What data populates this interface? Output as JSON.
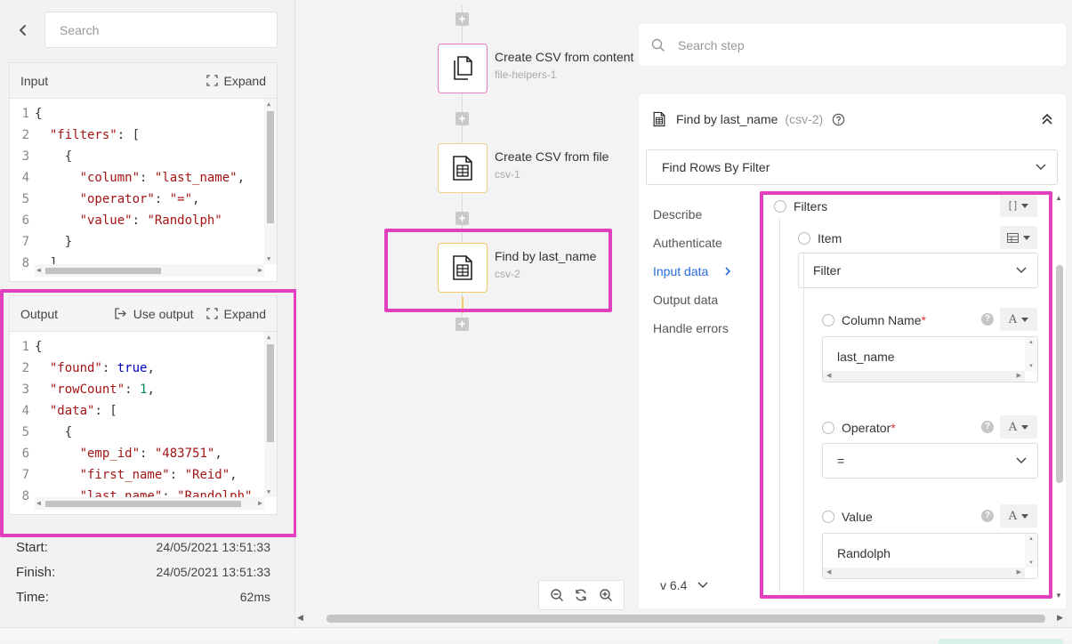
{
  "left": {
    "search_placeholder": "Search",
    "input_panel": {
      "title": "Input",
      "expand_label": "Expand",
      "lines": [
        {
          "n": "1",
          "html": "{"
        },
        {
          "n": "2",
          "html": "  <span class=\"key\">\"filters\"</span>: ["
        },
        {
          "n": "3",
          "html": "    {"
        },
        {
          "n": "4",
          "html": "      <span class=\"key\">\"column\"</span>: <span class=\"str\">\"last_name\"</span>,"
        },
        {
          "n": "5",
          "html": "      <span class=\"key\">\"operator\"</span>: <span class=\"str\">\"=\"</span>,"
        },
        {
          "n": "6",
          "html": "      <span class=\"key\">\"value\"</span>: <span class=\"str\">\"Randolph\"</span>"
        },
        {
          "n": "7",
          "html": "    }"
        },
        {
          "n": "8",
          "html": "  ],"
        }
      ]
    },
    "output_panel": {
      "title": "Output",
      "use_output_label": "Use output",
      "expand_label": "Expand",
      "lines": [
        {
          "n": "1",
          "html": "{"
        },
        {
          "n": "2",
          "html": "  <span class=\"key\">\"found\"</span>: <span class=\"kw\">true</span>,"
        },
        {
          "n": "3",
          "html": "  <span class=\"key\">\"rowCount\"</span>: <span class=\"num\">1</span>,"
        },
        {
          "n": "4",
          "html": "  <span class=\"key\">\"data\"</span>: ["
        },
        {
          "n": "5",
          "html": "    {"
        },
        {
          "n": "6",
          "html": "      <span class=\"key\">\"emp_id\"</span>: <span class=\"str\">\"483751\"</span>,"
        },
        {
          "n": "7",
          "html": "      <span class=\"key\">\"first_name\"</span>: <span class=\"str\">\"Reid\"</span>,"
        },
        {
          "n": "8",
          "html": "      <span class=\"key\">\"last_name\"</span>: <span class=\"str\">\"Randolph\"</span>,"
        }
      ]
    },
    "stats": {
      "start_label": "Start:",
      "start_value": "24/05/2021 13:51:33",
      "finish_label": "Finish:",
      "finish_value": "24/05/2021 13:51:33",
      "time_label": "Time:",
      "time_value": "62ms"
    }
  },
  "canvas": {
    "nodes": [
      {
        "title": "Create CSV from content",
        "sub": "file-helpers-1",
        "border": "#e87fc9",
        "icon": "copy-files-icon"
      },
      {
        "title": "Create CSV from file",
        "sub": "csv-1",
        "border": "#f2d08a",
        "icon": "spreadsheet-icon"
      },
      {
        "title": "Find by last_name",
        "sub": "csv-2",
        "border": "#f2c86a",
        "icon": "spreadsheet-icon"
      }
    ]
  },
  "step_search_placeholder": "Search step",
  "config": {
    "title": "Find by last_name",
    "sub": "(csv-2)",
    "method": "Find Rows By Filter",
    "nav": [
      "Describe",
      "Authenticate",
      "Input data",
      "Output data",
      "Handle errors"
    ],
    "active_nav": "Input data",
    "fields": {
      "filters_label": "Filters",
      "item_label": "Item",
      "item_type": "Filter",
      "column_label": "Column Name",
      "column_value": "last_name",
      "operator_label": "Operator",
      "operator_value": "=",
      "value_label": "Value",
      "value_value": "Randolph",
      "required_mark": "*",
      "type_glyph": "A"
    },
    "version": "v 6.4"
  },
  "colors": {
    "highlight": "#e43fbf",
    "accent": "#2a6cd9",
    "required": "#dd3333"
  }
}
